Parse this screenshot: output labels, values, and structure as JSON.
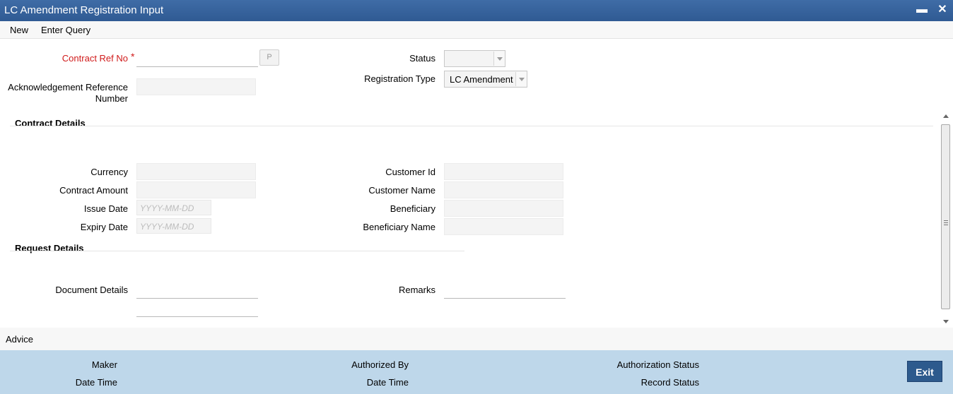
{
  "window": {
    "title": "LC Amendment Registration Input",
    "minimize_glyph": "▬",
    "close_glyph": "✕"
  },
  "menu": {
    "new_label": "New",
    "enter_query_label": "Enter Query"
  },
  "header": {
    "contract_ref_label": "Contract Ref No",
    "required_mark": "*",
    "contract_ref_value": "",
    "pick_button_label": "P",
    "ack_ref_label_line1": "Acknowledgement Reference",
    "ack_ref_label_line2": "Number",
    "ack_ref_value": "",
    "status_label": "Status",
    "status_value": "",
    "registration_type_label": "Registration Type",
    "registration_type_value": "LC Amendment"
  },
  "contract_details": {
    "section_title": "Contract Details",
    "currency_label": "Currency",
    "contract_amount_label": "Contract Amount",
    "issue_date_label": "Issue Date",
    "issue_date_placeholder": "YYYY-MM-DD",
    "expiry_date_label": "Expiry Date",
    "expiry_date_placeholder": "YYYY-MM-DD",
    "customer_id_label": "Customer Id",
    "customer_name_label": "Customer Name",
    "beneficiary_label": "Beneficiary",
    "beneficiary_name_label": "Beneficiary Name"
  },
  "request_details": {
    "section_title": "Request Details",
    "document_details_label": "Document Details",
    "remarks_label": "Remarks"
  },
  "advice": {
    "label": "Advice"
  },
  "footer": {
    "maker_label": "Maker",
    "date_time_label_1": "Date Time",
    "authorized_by_label": "Authorized By",
    "date_time_label_2": "Date Time",
    "authorization_status_label": "Authorization Status",
    "record_status_label": "Record Status",
    "exit_label": "Exit"
  },
  "colors": {
    "title_bar": "#2f5a93",
    "required_label": "#d01a1a",
    "footer_background": "#bed7ea",
    "exit_button": "#2d5a8d"
  }
}
